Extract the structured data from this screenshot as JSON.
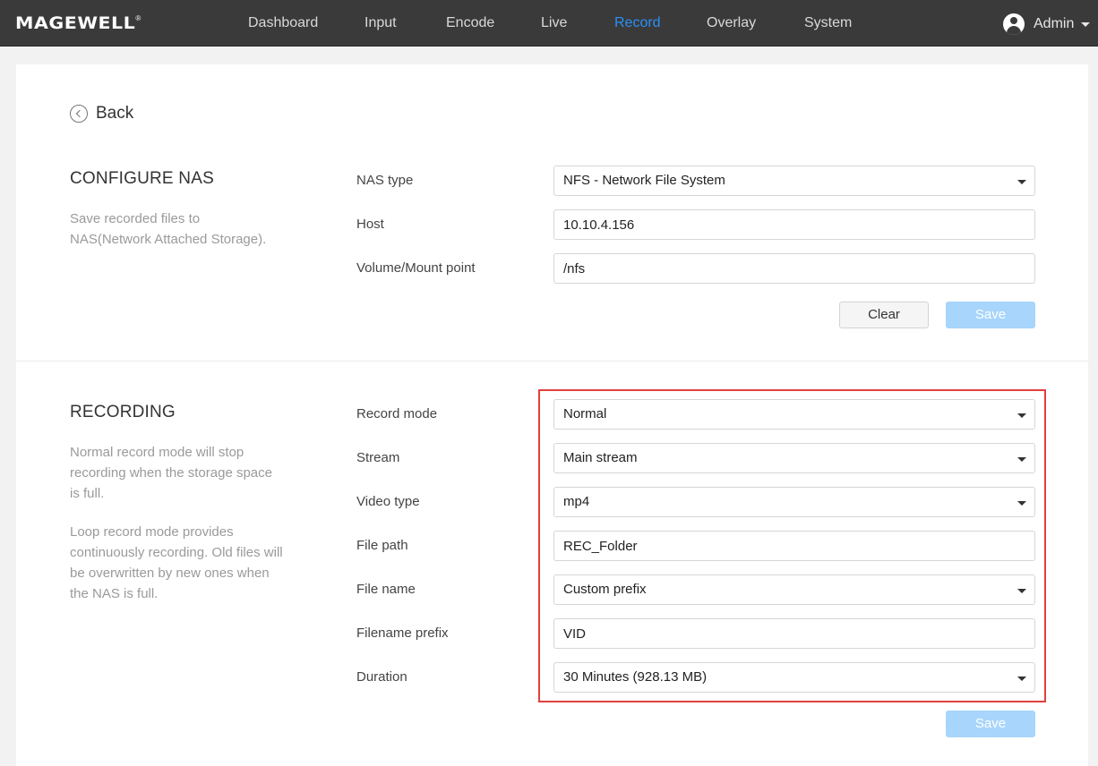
{
  "brand": {
    "name": "MAGEWELL",
    "mark": "®"
  },
  "nav": {
    "items": [
      {
        "label": "Dashboard"
      },
      {
        "label": "Input"
      },
      {
        "label": "Encode"
      },
      {
        "label": "Live"
      },
      {
        "label": "Record",
        "active": true
      },
      {
        "label": "Overlay"
      },
      {
        "label": "System"
      }
    ],
    "user": "Admin"
  },
  "colors": {
    "topbar": "#3a3a3a",
    "accent": "#2a8ff7",
    "save_disabled": "#a7d5fc",
    "highlight": "#e0403f"
  },
  "back": {
    "label": "Back"
  },
  "nas": {
    "title": "CONFIGURE NAS",
    "description": "Save recorded files to NAS(Network Attached Storage).",
    "fields": {
      "nas_type": {
        "label": "NAS type",
        "value": "NFS - Network File System"
      },
      "host": {
        "label": "Host",
        "value": "10.10.4.156"
      },
      "mount": {
        "label": "Volume/Mount point",
        "value": "/nfs"
      }
    },
    "clear_label": "Clear",
    "save_label": "Save"
  },
  "recording": {
    "title": "RECORDING",
    "description_1": "Normal record mode will stop recording when the storage space is full.",
    "description_2": "Loop record mode provides continuously recording. Old files will be overwritten by new ones when the NAS is full.",
    "fields": {
      "record_mode": {
        "label": "Record mode",
        "value": "Normal"
      },
      "stream": {
        "label": "Stream",
        "value": "Main stream"
      },
      "video_type": {
        "label": "Video type",
        "value": "mp4"
      },
      "file_path": {
        "label": "File path",
        "value": "REC_Folder"
      },
      "file_name": {
        "label": "File name",
        "value": "Custom prefix"
      },
      "filename_prefix": {
        "label": "Filename prefix",
        "value": "VID"
      },
      "duration": {
        "label": "Duration",
        "value": "30 Minutes (928.13 MB)"
      }
    },
    "save_label": "Save"
  }
}
